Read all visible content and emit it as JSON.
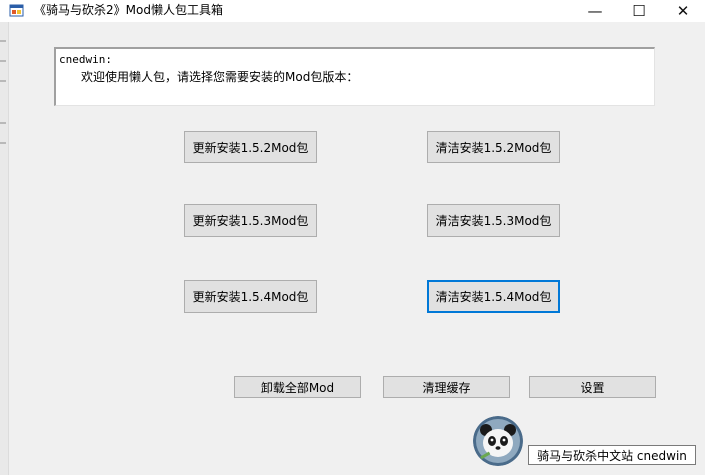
{
  "window": {
    "title": "《骑马与砍杀2》Mod懒人包工具箱",
    "minimize_glyph": "—",
    "maximize_glyph": "☐",
    "close_glyph": "✕"
  },
  "message": {
    "line1": "cnedwin:",
    "line2": "欢迎使用懒人包，请选择您需要安装的Mod包版本："
  },
  "install_buttons": [
    {
      "update": "更新安装1.5.2Mod包",
      "clean": "清洁安装1.5.2Mod包"
    },
    {
      "update": "更新安装1.5.3Mod包",
      "clean": "清洁安装1.5.3Mod包"
    },
    {
      "update": "更新安装1.5.4Mod包",
      "clean": "清洁安装1.5.4Mod包"
    }
  ],
  "bottom_buttons": {
    "uninstall": "卸载全部Mod",
    "clear_cache": "清理缓存",
    "settings": "设置"
  },
  "footer": {
    "site_label": "骑马与砍杀中文站 cnedwin"
  },
  "icons": {
    "app": "app-window-icon",
    "avatar": "panda-avatar"
  },
  "colors": {
    "focus": "#0078d7",
    "button_face": "#e1e1e1",
    "client_bg": "#f0f0f0"
  }
}
